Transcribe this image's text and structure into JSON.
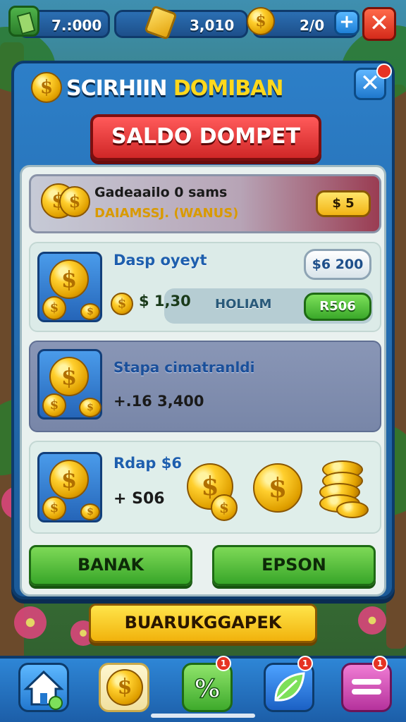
{
  "topbar": {
    "cash_value": "7.:000",
    "gold_value": "3,010",
    "coin_value": "2/0",
    "plus_label": "+",
    "close_label": "✕"
  },
  "panel": {
    "title_part1": "SCIRHIIN ",
    "title_part2": "DOMIBAN",
    "close_label": "✕",
    "close_badge": "•",
    "ribbon_title": "SALDO DOMPET"
  },
  "header_card": {
    "line1": "Gadeaailo 0 sams",
    "line2": "DAIAMSSJ. (WANUS)",
    "pill_label": "$ 5"
  },
  "card1": {
    "title": "Dasp oyeyt",
    "price_pill": "$6 200",
    "amount": "$ 1,30",
    "strip_text": "HOLIAM",
    "action_label": "R506"
  },
  "card2": {
    "title": "Stapa cimatranldi",
    "amount": "+.16  3,400"
  },
  "card3": {
    "title": "Rdap $6",
    "amount": "+ S06"
  },
  "buttons": {
    "left": "BANAK",
    "right": "EPSON",
    "main": "BUARUKGGAPEK"
  },
  "nav": {
    "badge_pct": "1",
    "badge_leaf": "1",
    "badge_menu": "1",
    "icons": [
      "home-icon",
      "coin-icon",
      "percent-icon",
      "leaf-icon",
      "menu-icon"
    ]
  },
  "colors": {
    "panel_blue": "#2d7fc8",
    "ribbon_red": "#d02727",
    "button_green": "#38a629",
    "cta_yellow": "#f1b20c"
  }
}
